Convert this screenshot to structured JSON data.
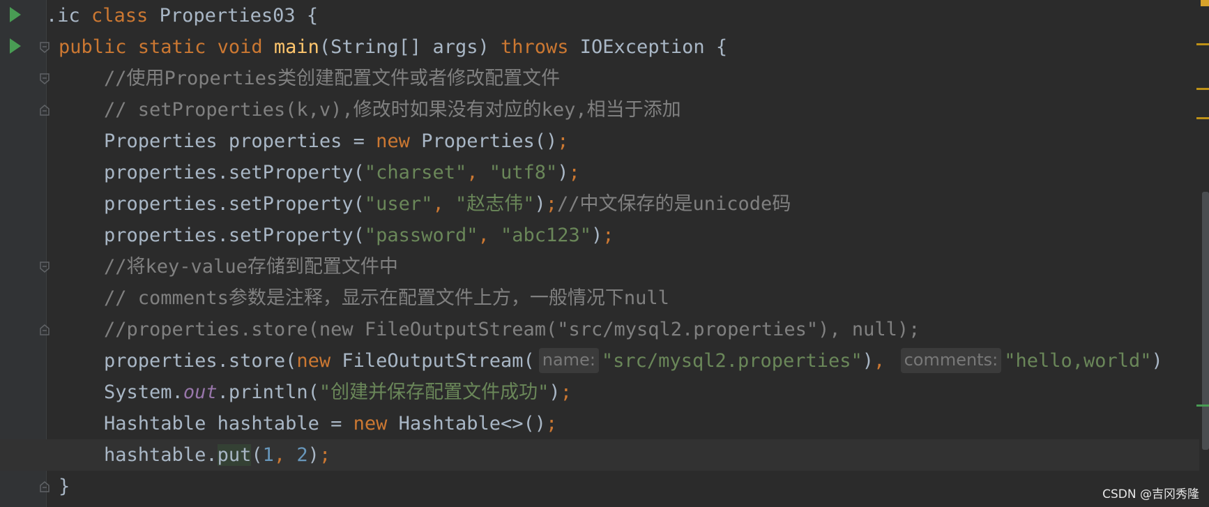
{
  "editor": {
    "theme_colors": {
      "background": "#2b2b2b",
      "gutter": "#313335",
      "keyword": "#cc7832",
      "method": "#ffc66d",
      "string": "#6a8759",
      "comment": "#808080",
      "number": "#6897bb",
      "field": "#9876aa",
      "default": "#a9b7c6"
    },
    "lines": {
      "l1": {
        "t1": ".ic ",
        "t2": "class ",
        "t3": "Properties03 {"
      },
      "l2": {
        "t1": "public static void ",
        "t2": "main",
        "t3": "(String[] args) ",
        "t4": "throws ",
        "t5": "IOException {"
      },
      "l3": {
        "t1": "    //使用Properties类创建配置文件或者修改配置文件"
      },
      "l4": {
        "t1": "    // setProperties(k,v),修改时如果没有对应的key,相当于添加"
      },
      "l5": {
        "t1": "    Properties properties = ",
        "t2": "new ",
        "t3": "Properties()",
        "t4": ";"
      },
      "l6": {
        "t1": "    properties.setProperty(",
        "t2": "\"charset\"",
        "t3": ", ",
        "t4": "\"utf8\"",
        "t5": ")",
        "t6": ";"
      },
      "l7": {
        "t1": "    properties.setProperty(",
        "t2": "\"user\"",
        "t3": ", ",
        "t4": "\"赵志伟\"",
        "t5": ")",
        "t6": ";",
        "t7": "//中文保存的是unicode码"
      },
      "l8": {
        "t1": "    properties.setProperty(",
        "t2": "\"password\"",
        "t3": ", ",
        "t4": "\"abc123\"",
        "t5": ")",
        "t6": ";"
      },
      "l9": {
        "t1": "    //将key-value存储到配置文件中"
      },
      "l10": {
        "t1": "    // comments参数是注释，显示在配置文件上方，一般情况下null"
      },
      "l11": {
        "t1": "    //properties.store(new FileOutputStream(\"src/mysql2.properties\"), null);"
      },
      "l12": {
        "t1": "    properties.store(",
        "t2": "new ",
        "t3": "FileOutputStream(",
        "hint_name": "name:",
        "t4": "\"src/mysql2.properties\"",
        "t5": ")",
        "t6": ", ",
        "hint_comments": "comments:",
        "t7": "\"hello,world\"",
        "t8": ")"
      },
      "l13": {
        "t1": "    System.",
        "t2": "out",
        "t3": ".println(",
        "t4": "\"创建并保存配置文件成功\"",
        "t5": ")",
        "t6": ";"
      },
      "l14": {
        "t1": "    Hashtable hashtable = ",
        "t2": "new ",
        "t3": "Hashtable<>()",
        "t4": ";"
      },
      "l15": {
        "t1": "    hashtable.",
        "t2": "put",
        "t3": "(",
        "t4": "1",
        "t5": ", ",
        "t6": "2",
        "t7": ")",
        "t8": ";"
      },
      "l16": {
        "t1": "}"
      }
    }
  },
  "watermark": "CSDN @吉冈秀隆"
}
